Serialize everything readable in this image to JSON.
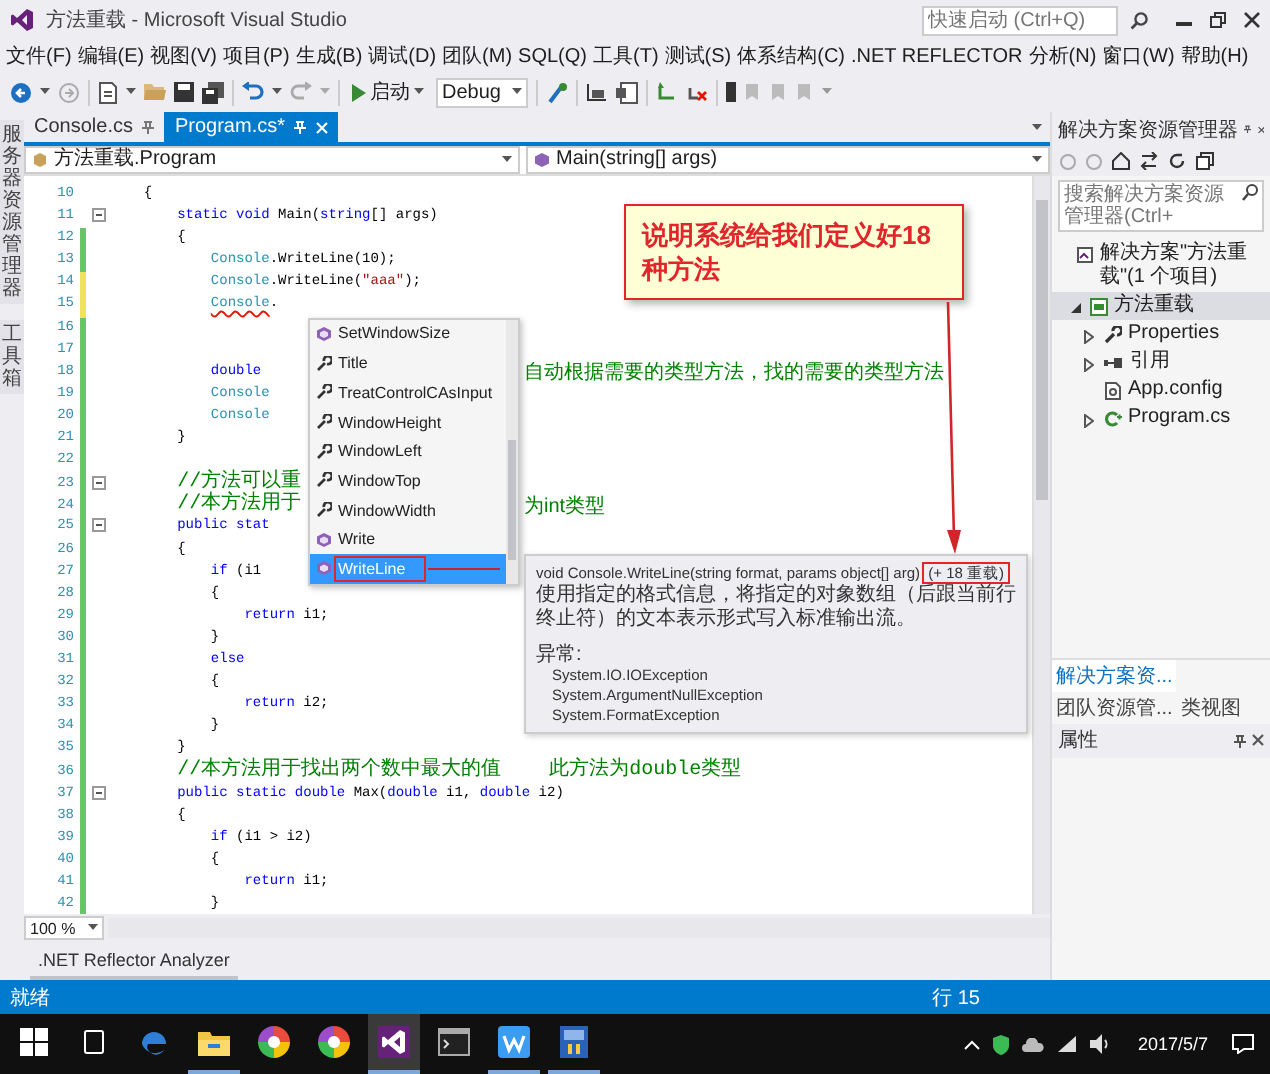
{
  "window": {
    "title": "方法重载 - Microsoft Visual Studio",
    "quick_launch": {
      "placeholder": "快速启动 (Ctrl+Q)"
    }
  },
  "menu": [
    "文件(F)",
    "编辑(E)",
    "视图(V)",
    "项目(P)",
    "生成(B)",
    "调试(D)",
    "团队(M)",
    "SQL(Q)",
    "工具(T)",
    "测试(S)",
    "体系结构(C)",
    ".NET REFLECTOR",
    "分析(N)",
    "窗口(W)",
    "帮助(H)"
  ],
  "toolbar": {
    "start": "启动",
    "configuration": "Debug"
  },
  "side_tabs": [
    "服务器资源管理器",
    "工具箱"
  ],
  "doc_tabs": [
    {
      "label": "Console.cs",
      "selected": false
    },
    {
      "label": "Program.cs*",
      "selected": true
    }
  ],
  "nav": {
    "type": "方法重载.Program",
    "member": "Main(string[] args)"
  },
  "code": {
    "lines": [
      {
        "number": "10",
        "segments": [
          {
            "kind": "plain",
            "text": "    {"
          }
        ]
      },
      {
        "number": "11",
        "fold": true,
        "segments": [
          {
            "kind": "keyword",
            "text": "        static void"
          },
          {
            "kind": "plain",
            "text": " Main("
          },
          {
            "kind": "keyword",
            "text": "string"
          },
          {
            "kind": "plain",
            "text": "[] args)"
          }
        ]
      },
      {
        "number": "12",
        "saved": true,
        "segments": [
          {
            "kind": "plain",
            "text": "        {"
          }
        ]
      },
      {
        "number": "13",
        "saved": true,
        "segments": [
          {
            "kind": "type",
            "text": "            Console"
          },
          {
            "kind": "plain",
            "text": ".WriteLine(10);"
          }
        ]
      },
      {
        "number": "14",
        "saved": false,
        "segments": [
          {
            "kind": "type",
            "text": "            Console"
          },
          {
            "kind": "plain",
            "text": ".WriteLine("
          },
          {
            "kind": "string",
            "text": "\"aaa\""
          },
          {
            "kind": "plain",
            "text": ");"
          }
        ]
      },
      {
        "number": "15",
        "saved": false,
        "segments": [
          {
            "kind": "type",
            "text": "            Console",
            "error": true
          },
          {
            "kind": "plain",
            "text": "."
          }
        ]
      },
      {
        "number": "16",
        "saved": true
      },
      {
        "number": "17",
        "saved": true
      },
      {
        "number": "18",
        "saved": true,
        "segments": [
          {
            "kind": "keyword",
            "text": "            double"
          }
        ],
        "tail": "自动根据需要的类型方法，找的需要的类型方法"
      },
      {
        "number": "19",
        "saved": true,
        "segments": [
          {
            "kind": "type",
            "text": "            Console"
          }
        ]
      },
      {
        "number": "20",
        "saved": true,
        "segments": [
          {
            "kind": "type",
            "text": "            Console"
          }
        ]
      },
      {
        "number": "21",
        "saved": true,
        "segments": [
          {
            "kind": "plain",
            "text": "        }"
          }
        ]
      },
      {
        "number": "22",
        "saved": true
      },
      {
        "number": "23",
        "saved": true,
        "fold": true,
        "segments": [
          {
            "kind": "comment",
            "text": "        //方法可以重"
          }
        ]
      },
      {
        "number": "24",
        "saved": true,
        "segments": [
          {
            "kind": "comment",
            "text": "        //本方法用于"
          }
        ],
        "tail": "为int类型"
      },
      {
        "number": "25",
        "saved": true,
        "fold": true,
        "segments": [
          {
            "kind": "keyword",
            "text": "        public stat"
          }
        ]
      },
      {
        "number": "26",
        "saved": true,
        "segments": [
          {
            "kind": "plain",
            "text": "        {"
          }
        ]
      },
      {
        "number": "27",
        "saved": true,
        "segments": [
          {
            "kind": "keyword",
            "text": "            if"
          },
          {
            "kind": "plain",
            "text": " (i1"
          }
        ]
      },
      {
        "number": "28",
        "saved": true,
        "segments": [
          {
            "kind": "plain",
            "text": "            {"
          }
        ]
      },
      {
        "number": "29",
        "saved": true,
        "segments": [
          {
            "kind": "keyword",
            "text": "                return"
          },
          {
            "kind": "plain",
            "text": " i1;"
          }
        ]
      },
      {
        "number": "30",
        "saved": true,
        "segments": [
          {
            "kind": "plain",
            "text": "            }"
          }
        ]
      },
      {
        "number": "31",
        "saved": true,
        "segments": [
          {
            "kind": "keyword",
            "text": "            else"
          }
        ]
      },
      {
        "number": "32",
        "saved": true,
        "segments": [
          {
            "kind": "plain",
            "text": "            {"
          }
        ]
      },
      {
        "number": "33",
        "saved": true,
        "segments": [
          {
            "kind": "keyword",
            "text": "                return"
          },
          {
            "kind": "plain",
            "text": " i2;"
          }
        ]
      },
      {
        "number": "34",
        "saved": true,
        "segments": [
          {
            "kind": "plain",
            "text": "            }"
          }
        ]
      },
      {
        "number": "35",
        "saved": true,
        "segments": [
          {
            "kind": "plain",
            "text": "        }"
          }
        ]
      },
      {
        "number": "36",
        "saved": true,
        "segments": [
          {
            "kind": "comment",
            "text": "        //本方法用于找出两个数中最大的值    此方法为double类型"
          }
        ]
      },
      {
        "number": "37",
        "saved": true,
        "fold": true,
        "segments": [
          {
            "kind": "keyword",
            "text": "        public static double"
          },
          {
            "kind": "plain",
            "text": " Max("
          },
          {
            "kind": "keyword",
            "text": "double"
          },
          {
            "kind": "plain",
            "text": " i1, "
          },
          {
            "kind": "keyword",
            "text": "double"
          },
          {
            "kind": "plain",
            "text": " i2)"
          }
        ]
      },
      {
        "number": "38",
        "saved": true,
        "segments": [
          {
            "kind": "plain",
            "text": "        {"
          }
        ]
      },
      {
        "number": "39",
        "saved": true,
        "segments": [
          {
            "kind": "keyword",
            "text": "            if"
          },
          {
            "kind": "plain",
            "text": " (i1 > i2)"
          }
        ]
      },
      {
        "number": "40",
        "saved": true,
        "segments": [
          {
            "kind": "plain",
            "text": "            {"
          }
        ]
      },
      {
        "number": "41",
        "saved": true,
        "segments": [
          {
            "kind": "keyword",
            "text": "                return"
          },
          {
            "kind": "plain",
            "text": " i1;"
          }
        ]
      },
      {
        "number": "42",
        "saved": true,
        "segments": [
          {
            "kind": "plain",
            "text": "            }"
          }
        ]
      }
    ]
  },
  "completion": {
    "items": [
      {
        "label": "SetWindowSize",
        "kind": "method",
        "selected": false
      },
      {
        "label": "Title",
        "kind": "property",
        "selected": false
      },
      {
        "label": "TreatControlCAsInput",
        "kind": "property",
        "selected": false
      },
      {
        "label": "WindowHeight",
        "kind": "property",
        "selected": false
      },
      {
        "label": "WindowLeft",
        "kind": "property",
        "selected": false
      },
      {
        "label": "WindowTop",
        "kind": "property",
        "selected": false
      },
      {
        "label": "WindowWidth",
        "kind": "property",
        "selected": false
      },
      {
        "label": "Write",
        "kind": "method",
        "selected": false
      },
      {
        "label": "WriteLine",
        "kind": "method",
        "selected": true,
        "boxed": true
      }
    ]
  },
  "tooltip": {
    "signature": "void Console.WriteLine(string format, params object[] arg)",
    "overloads": {
      "text": "(+ 18 重载)",
      "boxed": true
    },
    "description": "使用指定的格式信息，将指定的对象数组（后跟当前行终止符）的文本表示形式写入标准输出流。",
    "exceptions_heading": "异常:",
    "exceptions": [
      "System.IO.IOException",
      "System.ArgumentNullException",
      "System.FormatException"
    ]
  },
  "callout": {
    "text": "说明系统给我们定义好18种方法"
  },
  "zoom": "100 %",
  "bottom_tab": ".NET Reflector Analyzer",
  "solution_explorer": {
    "title": "解决方案资源管理器",
    "search": {
      "placeholder": "搜索解决方案资源管理器(Ctrl+"
    },
    "tree": [
      {
        "label": "解决方案\"方法重载\"(1 个项目)",
        "kind": "solution",
        "selected": false,
        "children": [
          {
            "label": "方法重载",
            "kind": "project",
            "selected": true,
            "expanded": true,
            "children": [
              {
                "label": "Properties",
                "kind": "properties",
                "selected": false,
                "expanded": false
              },
              {
                "label": "引用",
                "kind": "references",
                "selected": false,
                "expanded": false
              },
              {
                "label": "App.config",
                "kind": "config",
                "selected": false
              },
              {
                "label": "Program.cs",
                "kind": "csharp",
                "selected": false,
                "expanded": false
              }
            ]
          }
        ]
      }
    ],
    "tabs": [
      {
        "label": "解决方案资...",
        "selected": true
      },
      {
        "label": "团队资源管...",
        "selected": false
      },
      {
        "label": "类视图",
        "selected": false
      }
    ]
  },
  "properties": {
    "title": "属性"
  },
  "status_bar": {
    "state": "就绪",
    "line": "行 15"
  },
  "taskbar": {
    "apps": [
      {
        "kind": "edge",
        "running": false,
        "selected": false
      },
      {
        "kind": "explorer",
        "running": true,
        "selected": false
      },
      {
        "kind": "wheel",
        "running": false,
        "selected": false
      },
      {
        "kind": "wheel",
        "running": false,
        "selected": false
      },
      {
        "kind": "vs",
        "running": true,
        "selected": true
      },
      {
        "kind": "terminal",
        "running": false,
        "selected": false
      },
      {
        "kind": "word",
        "running": true,
        "selected": false
      },
      {
        "kind": "media",
        "running": true,
        "selected": false
      }
    ],
    "date": "2017/5/7"
  }
}
